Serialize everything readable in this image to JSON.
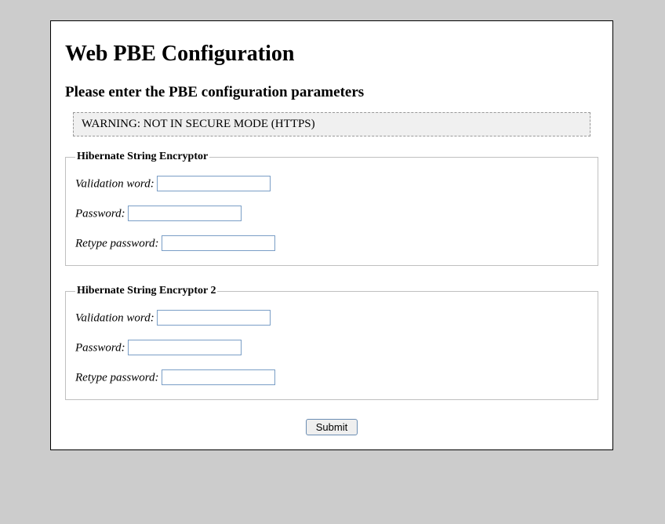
{
  "title": "Web PBE Configuration",
  "subtitle": "Please enter the PBE configuration parameters",
  "warning": "WARNING: NOT IN SECURE MODE (HTTPS)",
  "groups": [
    {
      "legend": "Hibernate String Encryptor",
      "validation_label": "Validation word:",
      "validation_value": "",
      "password_label": "Password:",
      "password_value": "",
      "retype_label": "Retype password:",
      "retype_value": ""
    },
    {
      "legend": "Hibernate String Encryptor 2",
      "validation_label": "Validation word:",
      "validation_value": "",
      "password_label": "Password:",
      "password_value": "",
      "retype_label": "Retype password:",
      "retype_value": ""
    }
  ],
  "submit_label": "Submit"
}
